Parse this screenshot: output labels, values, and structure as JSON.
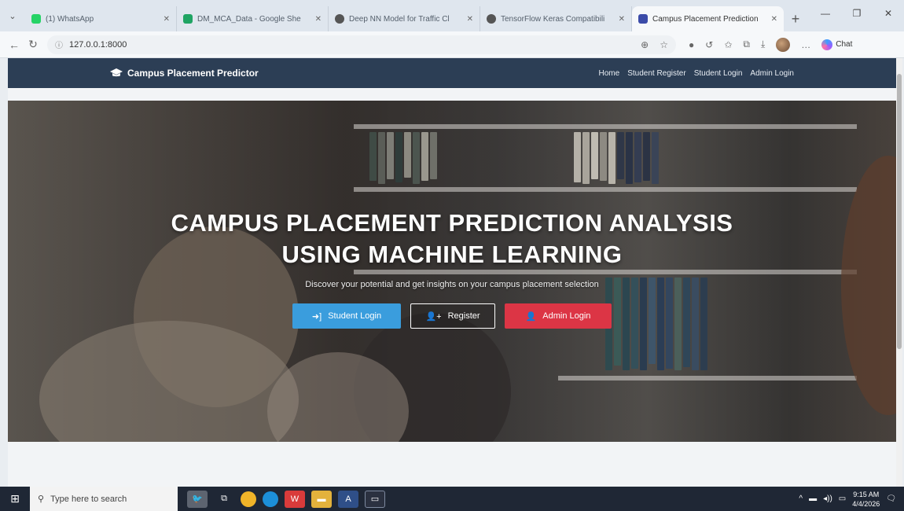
{
  "browser": {
    "tabs": [
      {
        "title": "(1) WhatsApp",
        "color": "#25d366",
        "active": false
      },
      {
        "title": "DM_MCA_Data - Google She",
        "color": "#1fa463",
        "active": false
      },
      {
        "title": "Deep NN Model for Traffic Cl",
        "color": "#555555",
        "active": false
      },
      {
        "title": "TensorFlow Keras Compatibili",
        "color": "#555555",
        "active": false
      },
      {
        "title": "Campus Placement Prediction",
        "color": "#3b4ba8",
        "active": true
      }
    ],
    "url": "127.0.0.1:8000",
    "copilot_label": "Chat"
  },
  "navbar": {
    "brand": "Campus Placement Predictor",
    "links": [
      "Home",
      "Student Register",
      "Student Login",
      "Admin Login"
    ]
  },
  "hero": {
    "title_line1": "CAMPUS PLACEMENT PREDICTION ANALYSIS",
    "title_line2": "USING MACHINE LEARNING",
    "subtitle": "Discover your potential and get insights on your campus placement selection",
    "buttons": {
      "student_login": "Student Login",
      "register": "Register",
      "admin_login": "Admin Login"
    }
  },
  "taskbar": {
    "search_placeholder": "Type here to search",
    "time": "9:15 AM",
    "date": "4/4/2026"
  }
}
